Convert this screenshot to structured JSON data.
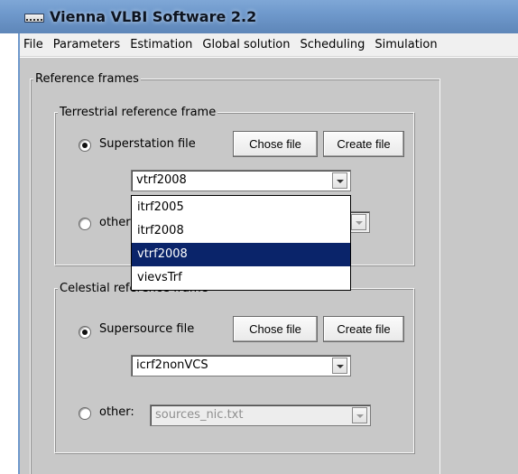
{
  "window": {
    "title": "Vienna VLBI Software 2.2",
    "title_bar_color": "#6f99cc",
    "panel_color": "#c8c8c8"
  },
  "menu": {
    "items": [
      "File",
      "Parameters",
      "Estimation",
      "Global solution",
      "Scheduling",
      "Simulation"
    ]
  },
  "reference_frames": {
    "legend": "Reference frames",
    "terrestrial": {
      "legend": "Terrestrial reference frame",
      "superstation_label": "Superstation file",
      "superstation_selected": true,
      "chose_file_label": "Chose file",
      "create_file_label": "Create file",
      "combo_value": "vtrf2008",
      "other_label": "other:",
      "other_selected": false,
      "dropdown": {
        "options": [
          "itrf2005",
          "itrf2008",
          "vtrf2008",
          "vievsTrf"
        ],
        "highlighted_index": 2,
        "highlight_color": "#0a246a"
      }
    },
    "celestial": {
      "legend": "Celestial reference frame",
      "supersource_label": "Supersource file",
      "supersource_selected": true,
      "chose_file_label": "Chose file",
      "create_file_label": "Create file",
      "combo_value": "icrf2nonVCS",
      "other_label": "other:",
      "other_selected": false,
      "other_value": "sources_nic.txt"
    }
  }
}
